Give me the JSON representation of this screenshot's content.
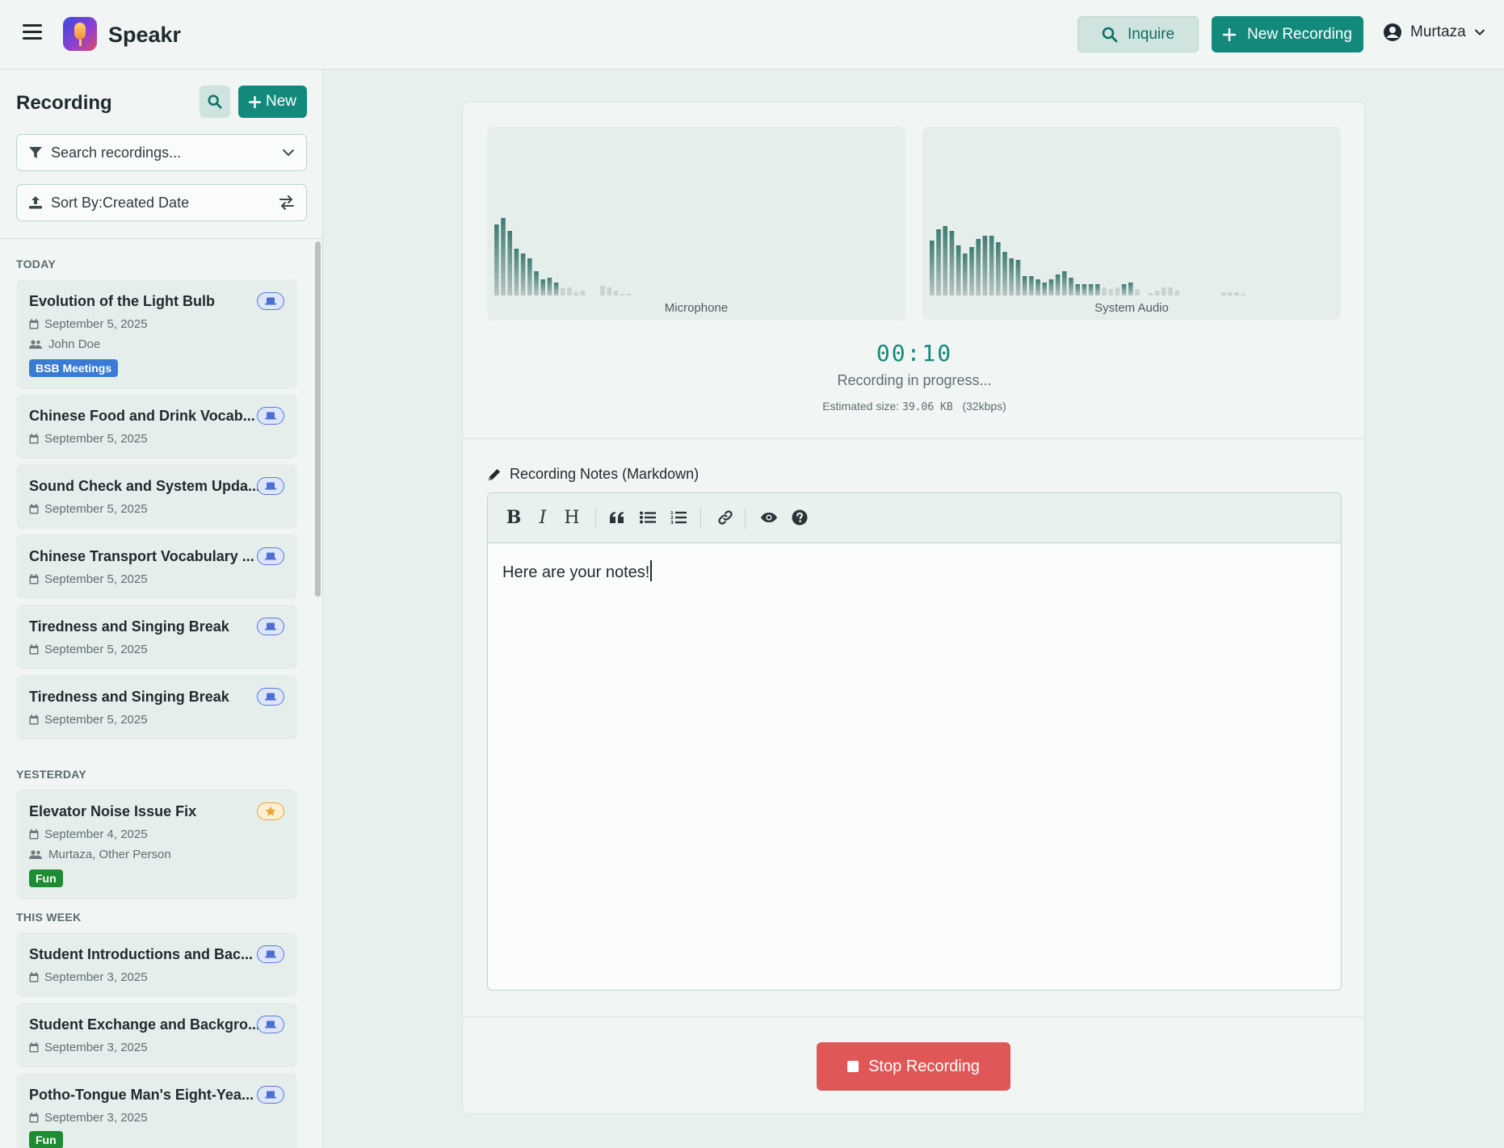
{
  "app": {
    "name": "Speakr"
  },
  "header": {
    "inquire_label": "Inquire",
    "new_recording_label": "New Recording",
    "user_name": "Murtaza"
  },
  "sidebar": {
    "title": "Recording",
    "new_label": "New",
    "search_placeholder": "Search recordings...",
    "sort_label": "Sort By:Created Date",
    "sections": {
      "today": "TODAY",
      "yesterday": "YESTERDAY",
      "this_week": "THIS WEEK"
    },
    "items": [
      {
        "title": "Evolution of the Light Bulb",
        "date": "September 5, 2025",
        "people": "John Doe",
        "tag": "BSB Meetings",
        "tag_color": "#3a7bd5",
        "badge": "laptop"
      },
      {
        "title": "Chinese Food and Drink Vocab...",
        "date": "September 5, 2025",
        "badge": "laptop"
      },
      {
        "title": "Sound Check and System Upda...",
        "date": "September 5, 2025",
        "badge": "laptop"
      },
      {
        "title": "Chinese Transport Vocabulary ...",
        "date": "September 5, 2025",
        "badge": "laptop"
      },
      {
        "title": "Tiredness and Singing Break",
        "date": "September 5, 2025",
        "badge": "laptop"
      },
      {
        "title": "Tiredness and Singing Break",
        "date": "September 5, 2025",
        "badge": "laptop"
      },
      {
        "title": "Elevator Noise Issue Fix",
        "date": "September 4, 2025",
        "people": "Murtaza, Other Person",
        "tag": "Fun",
        "tag_color": "#1e8c33",
        "badge": "star"
      },
      {
        "title": "Student Introductions and Bac...",
        "date": "September 3, 2025",
        "badge": "laptop"
      },
      {
        "title": "Student Exchange and Backgro...",
        "date": "September 3, 2025",
        "badge": "laptop"
      },
      {
        "title": "Potho-Tongue Man's Eight-Yea...",
        "date": "September 3, 2025",
        "tag": "Fun",
        "tag_color": "#1e8c33",
        "badge": "laptop"
      }
    ]
  },
  "recorder": {
    "mic_label": "Microphone",
    "system_label": "System Audio",
    "timer": "00:10",
    "status": "Recording in progress...",
    "estimated_prefix": "Estimated size:",
    "estimated_size": "39.06 KB",
    "bitrate": "(32kbps)",
    "notes_label": "Recording Notes (Markdown)",
    "notes_text": "Here are your notes!",
    "stop_label": "Stop Recording"
  },
  "colors": {
    "accent": "#13897c",
    "stop": "#e05757",
    "bar_dark": "#3e7d72",
    "bar_light": "#b8c4c2"
  }
}
